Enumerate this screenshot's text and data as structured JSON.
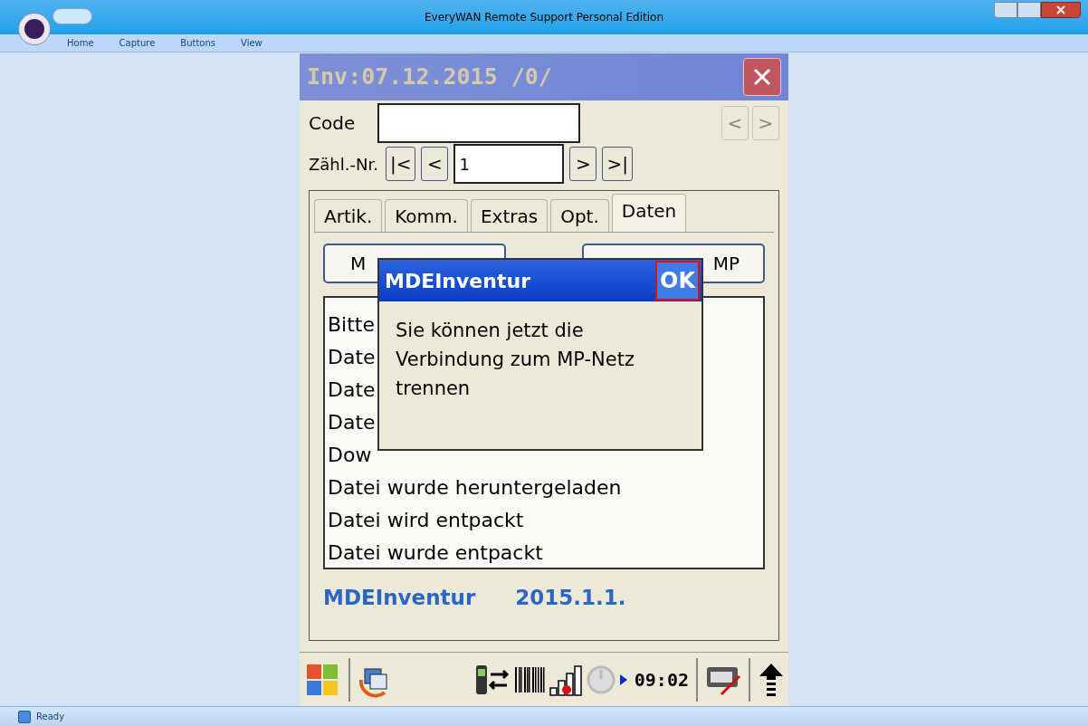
{
  "window": {
    "title": "EveryWAN Remote Support Personal Edition"
  },
  "ribbon_tabs": [
    {
      "label": "Home"
    },
    {
      "label": "Capture"
    },
    {
      "label": "Buttons"
    },
    {
      "label": "View"
    }
  ],
  "device": {
    "title": "Inv:07.12.2015 /0/",
    "code": {
      "label": "Code"
    },
    "code_nav": [
      {
        "label": "<",
        "disabled": true
      },
      {
        "label": ">",
        "disabled": true
      }
    ],
    "counter": {
      "label": "Zähl.-Nr.",
      "value": "1",
      "buttons_before": [
        "|<",
        "<"
      ],
      "buttons_after": [
        ">",
        ">|"
      ]
    },
    "tabs": [
      {
        "label": "Artik.",
        "selected": false
      },
      {
        "label": "Komm.",
        "selected": false
      },
      {
        "label": "Extras",
        "selected": false
      },
      {
        "label": "Opt.",
        "selected": false
      },
      {
        "label": "Daten",
        "selected": true
      }
    ],
    "action_buttons": [
      "M",
      "MP"
    ],
    "log": [
      "Bitte",
      "Date",
      "Date",
      "Date",
      "Dow",
      "Datei wurde heruntergeladen",
      "Datei wird entpackt",
      "Datei wurde entpackt"
    ],
    "app_name": "MDEInventur",
    "version": "2015.1.1.",
    "taskbar": {
      "time": "09:02"
    },
    "dialog": {
      "title": "MDEInventur",
      "ok": "OK",
      "message": "Sie können jetzt die Verbindung zum MP-Netz trennen"
    }
  },
  "status_bar": {
    "text": "Ready"
  }
}
